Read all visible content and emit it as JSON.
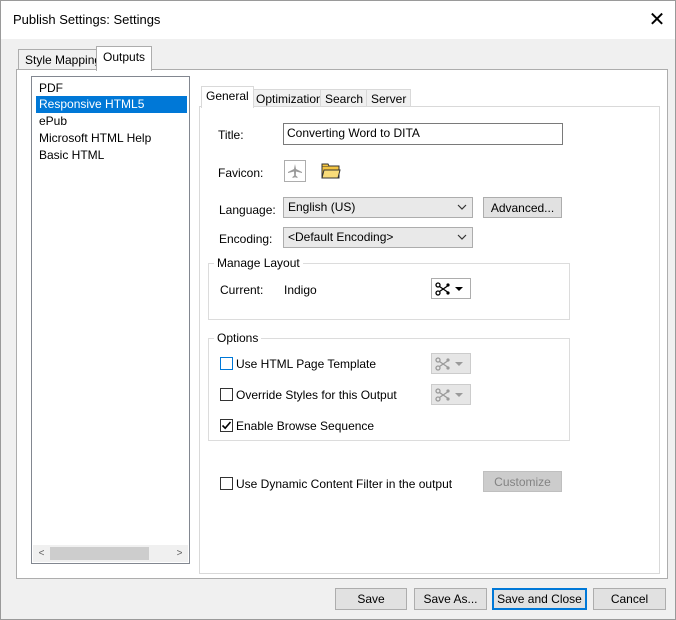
{
  "window": {
    "title": "Publish Settings: Settings",
    "close_glyph": "✕"
  },
  "outer_tabs": [
    {
      "label": "Style Mapping",
      "active": false
    },
    {
      "label": "Outputs",
      "active": true
    }
  ],
  "outputs_list": {
    "items": [
      {
        "label": "PDF",
        "selected": false
      },
      {
        "label": "Responsive HTML5",
        "selected": true
      },
      {
        "label": "ePub",
        "selected": false
      },
      {
        "label": "Microsoft HTML Help",
        "selected": false
      },
      {
        "label": "Basic HTML",
        "selected": false
      }
    ],
    "scroll_left_glyph": "<",
    "scroll_right_glyph": ">"
  },
  "inner_tabs": [
    {
      "label": "General",
      "active": true
    },
    {
      "label": "Optimization",
      "active": false
    },
    {
      "label": "Search",
      "active": false
    },
    {
      "label": "Server",
      "active": false
    }
  ],
  "general": {
    "title_label": "Title:",
    "title_value": "Converting Word to DITA",
    "favicon_label": "Favicon:",
    "favicon_icon": "airplane-icon",
    "browse_icon": "open-folder-icon",
    "language_label": "Language:",
    "language_value": "English (US)",
    "advanced_button": "Advanced...",
    "encoding_label": "Encoding:",
    "encoding_value": "<Default Encoding>"
  },
  "manage_layout": {
    "group_title": "Manage Layout",
    "current_label": "Current:",
    "current_value": "Indigo",
    "layout_icon": "scissors-icon"
  },
  "options": {
    "group_title": "Options",
    "use_template": {
      "label": "Use HTML Page Template",
      "checked": false
    },
    "override_styles": {
      "label": "Override Styles for this Output",
      "checked": false
    },
    "browse_sequence": {
      "label": "Enable Browse Sequence",
      "checked": true
    }
  },
  "dcf": {
    "label": "Use Dynamic Content Filter in the output",
    "checked": false,
    "customize_button": "Customize"
  },
  "footer": {
    "save": "Save",
    "save_as": "Save As...",
    "save_close": "Save and Close",
    "cancel": "Cancel"
  },
  "colors": {
    "selection": "#0078d7",
    "dialog_bg": "#f0f0f0",
    "panel_bg": "#ffffff"
  }
}
